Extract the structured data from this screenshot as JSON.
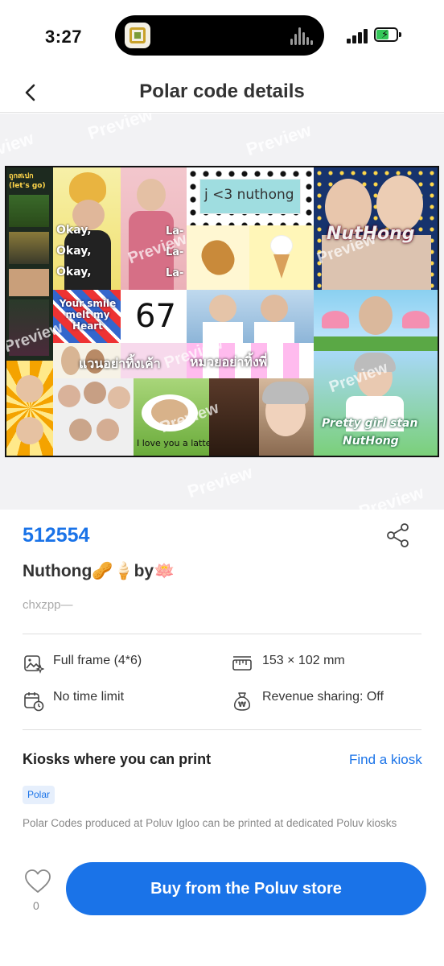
{
  "status_bar": {
    "time": "3:27"
  },
  "nav": {
    "title": "Polar code details",
    "back_icon": "chevron-left-icon"
  },
  "preview": {
    "watermark": "Preview",
    "collage_texts": {
      "note_lines": [
        "ถูกสเปก",
        "(let's go)"
      ],
      "okay": "Okay,",
      "lala": "La-",
      "nuthong_label": "j <3 nuthong",
      "nuthong_title": "NutHong",
      "your_smile": "Your smile melt my Heart",
      "number": "67",
      "thai_left": "แวนอย่าทิ้งเค้า",
      "thai_right": "หมวยอย่าทิ้งพี่",
      "latte": "I love you a latte.",
      "pretty": "Pretty girl stan",
      "pretty_sub": "NutHong"
    }
  },
  "details": {
    "code": "512554",
    "name": "Nuthong🥜🍦by🪷",
    "author": "chxzpp—",
    "share_icon": "share-icon",
    "specs": [
      {
        "icon": "image-sparkle-icon",
        "label": "Full frame (4*6)"
      },
      {
        "icon": "ruler-icon",
        "label": "153 × 102 mm"
      },
      {
        "icon": "calendar-clock-icon",
        "label": "No time limit"
      },
      {
        "icon": "money-bag-icon",
        "label": "Revenue sharing: Off"
      }
    ]
  },
  "kiosks": {
    "title": "Kiosks where you can print",
    "find_link": "Find a kiosk",
    "tag": "Polar",
    "note": "Polar Codes produced at Poluv Igloo can be printed at dedicated Poluv kiosks"
  },
  "footer": {
    "like_icon": "heart-icon",
    "like_count": "0",
    "buy_label": "Buy from the Poluv store"
  },
  "colors": {
    "accent": "#1a73e8",
    "tag_bg": "#e6effc",
    "preview_bg": "#f2f2f4"
  }
}
